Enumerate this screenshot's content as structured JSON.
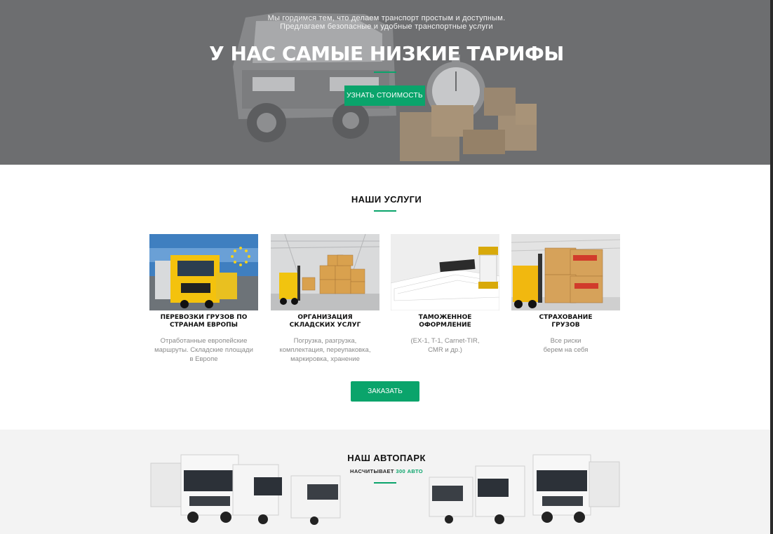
{
  "hero": {
    "subtitle_line1": "Мы гордимся тем, что делаем транспорт простым и доступным.",
    "subtitle_line2": "Предлагаем безопасные и удобные транспортные услуги",
    "title": "У НАС САМЫЕ НИЗКИЕ ТАРИФЫ",
    "button_label": "УЗНАТЬ СТОИМОСТЬ"
  },
  "services": {
    "title": "НАШИ УСЛУГИ",
    "order_button_label": "ЗАКАЗАТЬ",
    "items": [
      {
        "caption": "ПЕРЕВОЗКИ ГРУЗОВ ПО\nСТРАНАМ ЕВРОПЫ",
        "description": "Отработанные европейские\nмаршруты. Складские площади\nв Европе",
        "image": "yellow-truck-eu-photo"
      },
      {
        "caption": "ОРГАНИЗАЦИЯ\nСКЛАДСКИХ УСЛУГ",
        "description": "Погрузка, разгрузка,\nкомплектация, переупаковка,\nмаркировка, хранение",
        "image": "warehouse-forklift-photo"
      },
      {
        "caption": "ТАМОЖЕННОЕ\nОФОРМЛЕНИЕ",
        "description": "(EX-1, T-1, Carnet-TIR,\nCMR и др.)",
        "image": "documents-stamp-photo"
      },
      {
        "caption": "СТРАХОВАНИЕ\nГРУЗОВ",
        "description": "Все риски\nберем на себя",
        "image": "insured-boxes-forklift-photo"
      }
    ]
  },
  "fleet": {
    "title": "НАШ АВТОПАРК",
    "subtitle_prefix": "НАСЧИТЫВАЕТ",
    "subtitle_accent": "300 АВТО"
  },
  "colors": {
    "accent": "#0aa46b",
    "hero_overlay": "#6d6e70",
    "fleet_bg": "#f3f3f3"
  }
}
